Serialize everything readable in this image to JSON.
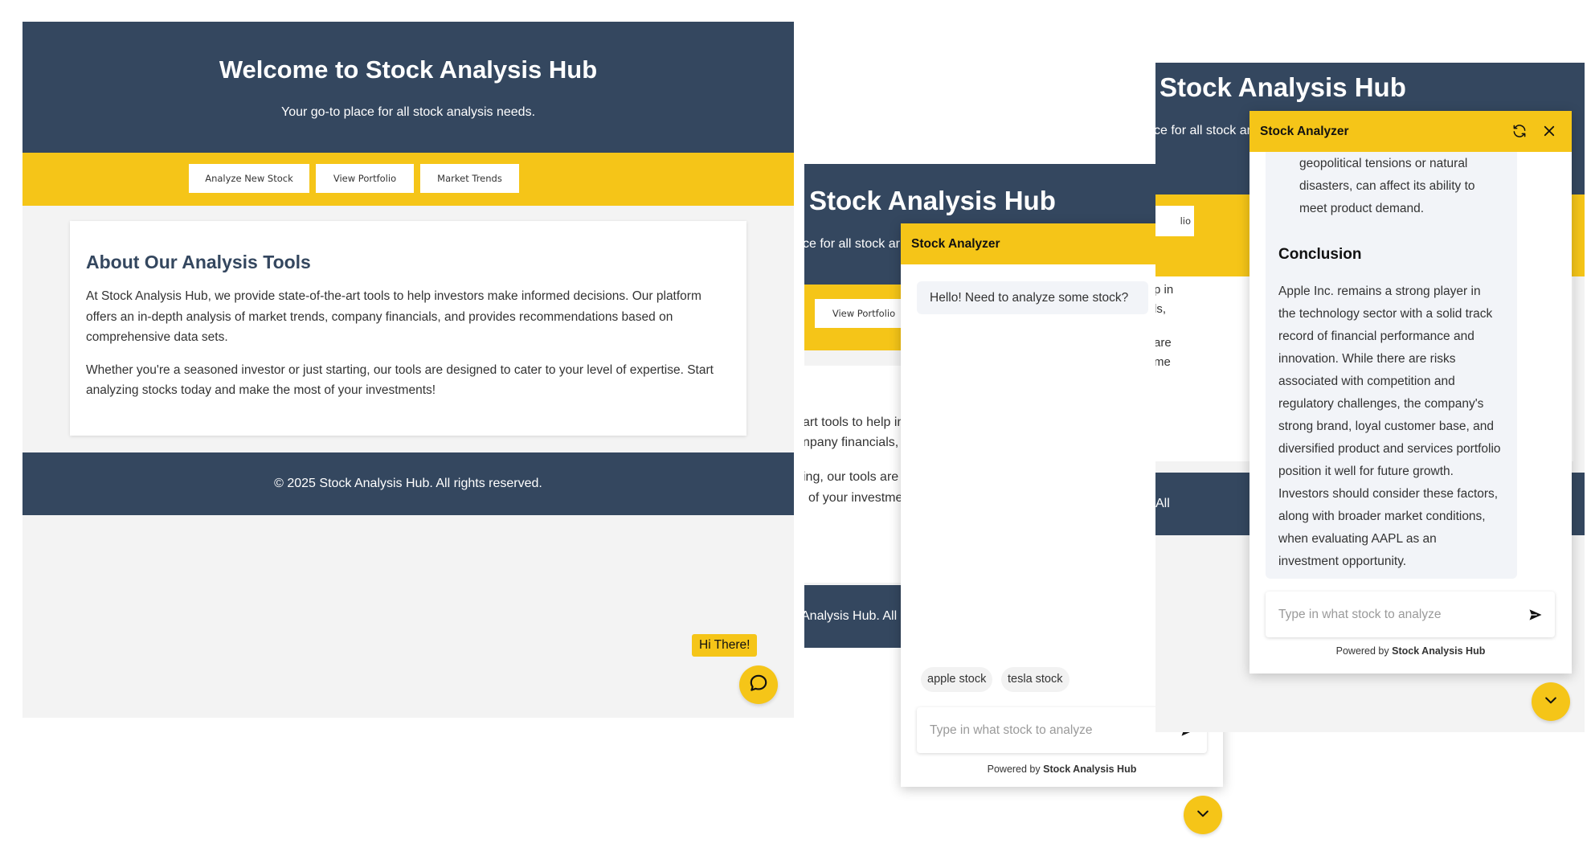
{
  "site": {
    "title": "Welcome to Stock Analysis Hub",
    "title_short": "Stock Analysis Hub",
    "tagline": "Your go-to place for all stock analysis needs.",
    "tagline_fragment": "ce for all stock ar",
    "tagline_fragment_2": "ce for all stock ar",
    "nav": [
      "Analyze New Stock",
      "View Portfolio",
      "Market Trends"
    ],
    "nav_fragment": "lio",
    "about": {
      "heading": "About Our Analysis Tools",
      "p1": "At Stock Analysis Hub, we provide state-of-the-art tools to help investors make informed decisions. Our platform offers an in-depth analysis of market trends, company financials, and provides recommendations based on comprehensive data sets.",
      "p2": "Whether you're a seasoned investor or just starting, our tools are designed to cater to your level of expertise. Start analyzing stocks today and make the most of your investments!"
    },
    "footer": "© 2025 Stock Analysis Hub. All rights reserved.",
    "p2_fragments": {
      "l1": "art tools to help in",
      "l2": "npany financials,",
      "l3": "ing, our tools are",
      "l4": "of your investme",
      "footer": "Analysis Hub. All r"
    },
    "p3_fragments": {
      "l1": "p in",
      "l2": "ls,",
      "l3": "are",
      "l4": "me",
      "footer": "All"
    }
  },
  "greeting_tooltip": "Hi There!",
  "chat": {
    "title": "Stock Analyzer",
    "greeting": "Hello! Need to analyze some stock?",
    "suggestions": [
      "apple stock",
      "tesla stock"
    ],
    "input_placeholder": "Type in what stock to analyze",
    "powered_prefix": "Powered by",
    "powered_brand": "Stock Analysis Hub",
    "answer": {
      "intro_lines": [
        "geopolitical tensions or natural",
        "disasters, can affect its ability to",
        "meet product demand."
      ],
      "conclusion_heading": "Conclusion",
      "conclusion_lines": [
        "Apple Inc. remains a strong player in",
        "the technology sector with a solid track",
        "record of financial performance and",
        "innovation. While there are risks",
        "associated with competition and",
        "regulatory challenges, the company's",
        "strong brand, loyal customer base, and",
        "diversified product and services portfolio",
        "position it well for future growth.",
        "Investors should consider these factors,",
        "along with broader market conditions,",
        "when evaluating AAPL as an",
        "investment opportunity."
      ]
    }
  },
  "icons": {
    "chat_open": "chat-bubble-icon",
    "refresh": "refresh-icon",
    "close": "close-icon",
    "send": "send-icon",
    "minimize": "chevron-down-icon"
  },
  "colors": {
    "navy": "#34475f",
    "yellow": "#f5c518",
    "page_bg": "#f3f3f3",
    "bubble_bg": "#f2f4f8"
  }
}
